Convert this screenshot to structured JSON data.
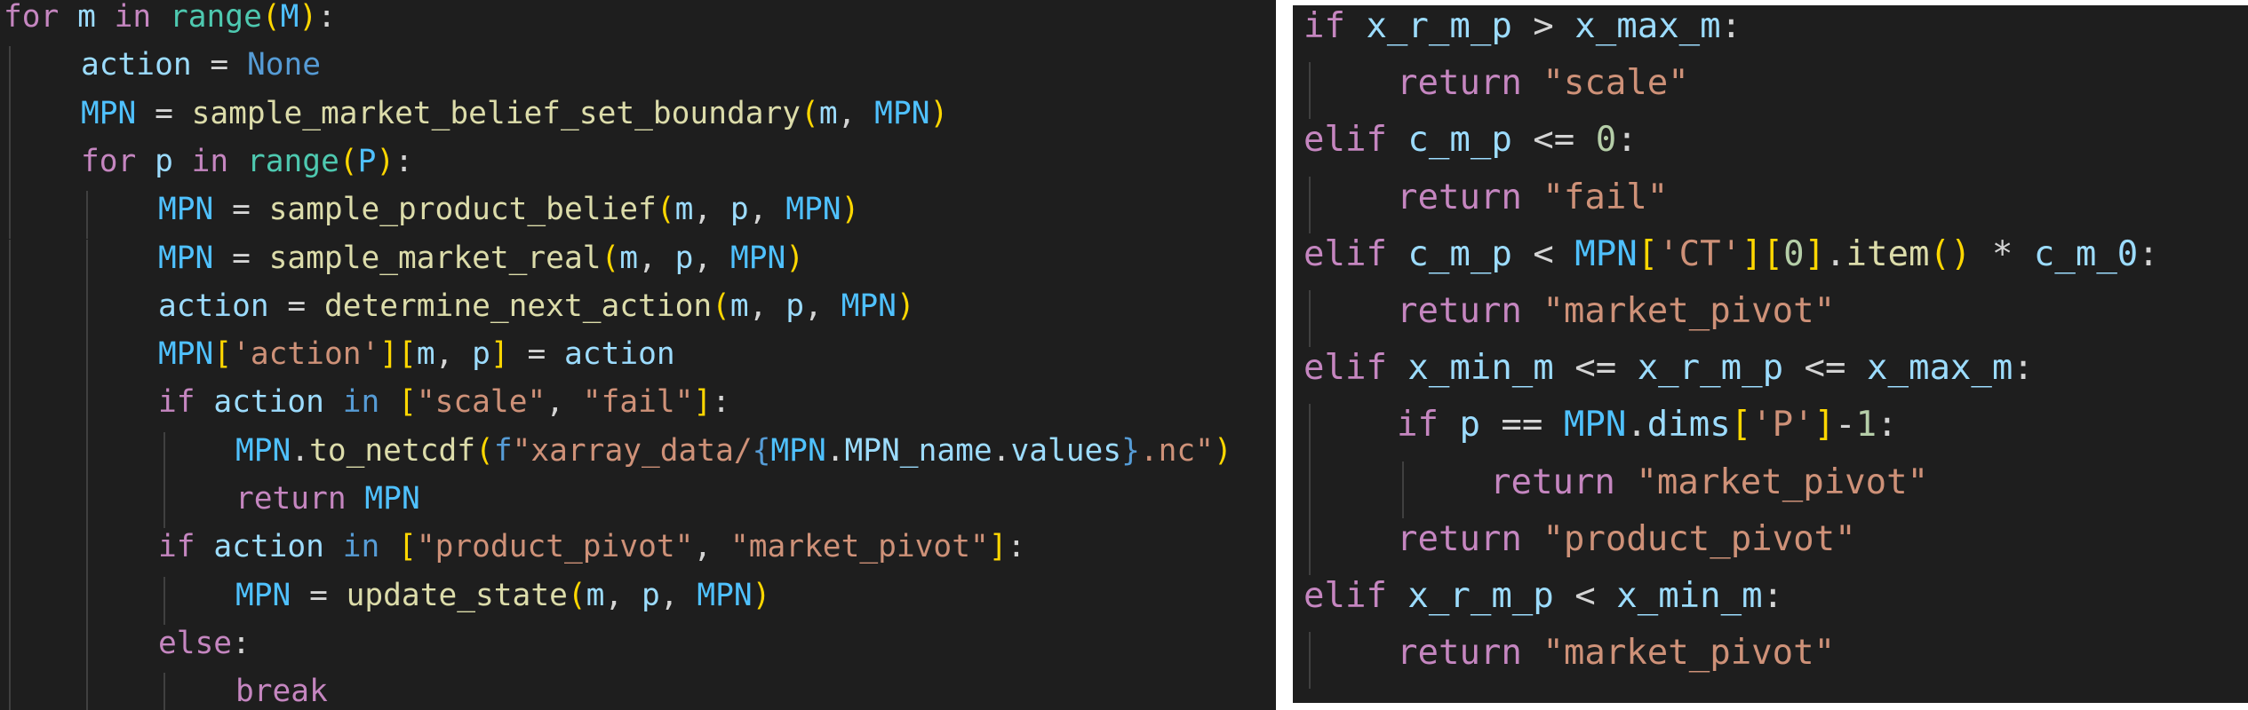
{
  "panels": [
    {
      "id": "left",
      "lines": [
        {
          "indent": 0,
          "tokens": [
            [
              "k",
              "for"
            ],
            [
              "o",
              " "
            ],
            [
              "v",
              "m"
            ],
            [
              "o",
              " "
            ],
            [
              "k",
              "in"
            ],
            [
              "o",
              " "
            ],
            [
              "b",
              "range"
            ],
            [
              "p1",
              "("
            ],
            [
              "c",
              "M"
            ],
            [
              "p1",
              ")"
            ],
            [
              "o",
              ":"
            ]
          ]
        },
        {
          "indent": 1,
          "tokens": [
            [
              "v",
              "action"
            ],
            [
              "o",
              " = "
            ],
            [
              "kb",
              "None"
            ]
          ]
        },
        {
          "indent": 1,
          "tokens": [
            [
              "c",
              "MPN"
            ],
            [
              "o",
              " = "
            ],
            [
              "f",
              "sample_market_belief_set_boundary"
            ],
            [
              "p1",
              "("
            ],
            [
              "v",
              "m"
            ],
            [
              "o",
              ", "
            ],
            [
              "c",
              "MPN"
            ],
            [
              "p1",
              ")"
            ]
          ]
        },
        {
          "indent": 1,
          "tokens": [
            [
              "k",
              "for"
            ],
            [
              "o",
              " "
            ],
            [
              "v",
              "p"
            ],
            [
              "o",
              " "
            ],
            [
              "k",
              "in"
            ],
            [
              "o",
              " "
            ],
            [
              "b",
              "range"
            ],
            [
              "p1",
              "("
            ],
            [
              "c",
              "P"
            ],
            [
              "p1",
              ")"
            ],
            [
              "o",
              ":"
            ]
          ]
        },
        {
          "indent": 2,
          "tokens": [
            [
              "c",
              "MPN"
            ],
            [
              "o",
              " = "
            ],
            [
              "f",
              "sample_product_belief"
            ],
            [
              "p1",
              "("
            ],
            [
              "v",
              "m"
            ],
            [
              "o",
              ", "
            ],
            [
              "v",
              "p"
            ],
            [
              "o",
              ", "
            ],
            [
              "c",
              "MPN"
            ],
            [
              "p1",
              ")"
            ]
          ]
        },
        {
          "indent": 2,
          "tokens": [
            [
              "c",
              "MPN"
            ],
            [
              "o",
              " = "
            ],
            [
              "f",
              "sample_market_real"
            ],
            [
              "p1",
              "("
            ],
            [
              "v",
              "m"
            ],
            [
              "o",
              ", "
            ],
            [
              "v",
              "p"
            ],
            [
              "o",
              ", "
            ],
            [
              "c",
              "MPN"
            ],
            [
              "p1",
              ")"
            ]
          ]
        },
        {
          "indent": 2,
          "tokens": [
            [
              "v",
              "action"
            ],
            [
              "o",
              " = "
            ],
            [
              "f",
              "determine_next_action"
            ],
            [
              "p1",
              "("
            ],
            [
              "v",
              "m"
            ],
            [
              "o",
              ", "
            ],
            [
              "v",
              "p"
            ],
            [
              "o",
              ", "
            ],
            [
              "c",
              "MPN"
            ],
            [
              "p1",
              ")"
            ]
          ]
        },
        {
          "indent": 2,
          "tokens": [
            [
              "c",
              "MPN"
            ],
            [
              "p1",
              "["
            ],
            [
              "s",
              "'action'"
            ],
            [
              "p1",
              "]"
            ],
            [
              "p1",
              "["
            ],
            [
              "v",
              "m"
            ],
            [
              "o",
              ", "
            ],
            [
              "v",
              "p"
            ],
            [
              "p1",
              "]"
            ],
            [
              "o",
              " = "
            ],
            [
              "v",
              "action"
            ]
          ]
        },
        {
          "indent": 2,
          "tokens": [
            [
              "k",
              "if"
            ],
            [
              "o",
              " "
            ],
            [
              "v",
              "action"
            ],
            [
              "o",
              " "
            ],
            [
              "kb",
              "in"
            ],
            [
              "o",
              " "
            ],
            [
              "p1",
              "["
            ],
            [
              "s",
              "\"scale\""
            ],
            [
              "o",
              ", "
            ],
            [
              "s",
              "\"fail\""
            ],
            [
              "p1",
              "]"
            ],
            [
              "o",
              ":"
            ]
          ]
        },
        {
          "indent": 3,
          "tokens": [
            [
              "c",
              "MPN"
            ],
            [
              "o",
              "."
            ],
            [
              "f",
              "to_netcdf"
            ],
            [
              "p1",
              "("
            ],
            [
              "kb",
              "f"
            ],
            [
              "s",
              "\"xarray_data/"
            ],
            [
              "kb",
              "{"
            ],
            [
              "c",
              "MPN"
            ],
            [
              "o",
              "."
            ],
            [
              "v",
              "MPN_name"
            ],
            [
              "o",
              "."
            ],
            [
              "v",
              "values"
            ],
            [
              "kb",
              "}"
            ],
            [
              "s",
              ".nc\""
            ],
            [
              "p1",
              ")"
            ]
          ]
        },
        {
          "indent": 3,
          "tokens": [
            [
              "k",
              "return"
            ],
            [
              "o",
              " "
            ],
            [
              "c",
              "MPN"
            ]
          ]
        },
        {
          "indent": 2,
          "tokens": [
            [
              "k",
              "if"
            ],
            [
              "o",
              " "
            ],
            [
              "v",
              "action"
            ],
            [
              "o",
              " "
            ],
            [
              "kb",
              "in"
            ],
            [
              "o",
              " "
            ],
            [
              "p1",
              "["
            ],
            [
              "s",
              "\"product_pivot\""
            ],
            [
              "o",
              ", "
            ],
            [
              "s",
              "\"market_pivot\""
            ],
            [
              "p1",
              "]"
            ],
            [
              "o",
              ":"
            ]
          ]
        },
        {
          "indent": 3,
          "tokens": [
            [
              "c",
              "MPN"
            ],
            [
              "o",
              " = "
            ],
            [
              "f",
              "update_state"
            ],
            [
              "p1",
              "("
            ],
            [
              "v",
              "m"
            ],
            [
              "o",
              ", "
            ],
            [
              "v",
              "p"
            ],
            [
              "o",
              ", "
            ],
            [
              "c",
              "MPN"
            ],
            [
              "p1",
              ")"
            ]
          ]
        },
        {
          "indent": 2,
          "tokens": [
            [
              "k",
              "else"
            ],
            [
              "o",
              ":"
            ]
          ]
        },
        {
          "indent": 3,
          "tokens": [
            [
              "k",
              "break"
            ]
          ]
        }
      ]
    },
    {
      "id": "right",
      "lines": [
        {
          "indent": 0,
          "tokens": [
            [
              "k",
              "if"
            ],
            [
              "o",
              " "
            ],
            [
              "v",
              "x_r_m_p"
            ],
            [
              "o",
              " > "
            ],
            [
              "v",
              "x_max_m"
            ],
            [
              "o",
              ":"
            ]
          ]
        },
        {
          "indent": 1,
          "tokens": [
            [
              "k",
              "return"
            ],
            [
              "o",
              " "
            ],
            [
              "s",
              "\"scale\""
            ]
          ]
        },
        {
          "indent": 0,
          "tokens": [
            [
              "k",
              "elif"
            ],
            [
              "o",
              " "
            ],
            [
              "v",
              "c_m_p"
            ],
            [
              "o",
              " <= "
            ],
            [
              "n",
              "0"
            ],
            [
              "o",
              ":"
            ]
          ]
        },
        {
          "indent": 1,
          "tokens": [
            [
              "k",
              "return"
            ],
            [
              "o",
              " "
            ],
            [
              "s",
              "\"fail\""
            ]
          ]
        },
        {
          "indent": 0,
          "tokens": [
            [
              "k",
              "elif"
            ],
            [
              "o",
              " "
            ],
            [
              "v",
              "c_m_p"
            ],
            [
              "o",
              " < "
            ],
            [
              "c",
              "MPN"
            ],
            [
              "p1",
              "["
            ],
            [
              "s",
              "'CT'"
            ],
            [
              "p1",
              "]"
            ],
            [
              "p1",
              "["
            ],
            [
              "n",
              "0"
            ],
            [
              "p1",
              "]"
            ],
            [
              "o",
              "."
            ],
            [
              "f",
              "item"
            ],
            [
              "p1",
              "()"
            ],
            [
              "o",
              " * "
            ],
            [
              "v",
              "c_m_0"
            ],
            [
              "o",
              ":"
            ]
          ]
        },
        {
          "indent": 1,
          "tokens": [
            [
              "k",
              "return"
            ],
            [
              "o",
              " "
            ],
            [
              "s",
              "\"market_pivot\""
            ]
          ]
        },
        {
          "indent": 0,
          "tokens": [
            [
              "k",
              "elif"
            ],
            [
              "o",
              " "
            ],
            [
              "v",
              "x_min_m"
            ],
            [
              "o",
              " <= "
            ],
            [
              "v",
              "x_r_m_p"
            ],
            [
              "o",
              " <= "
            ],
            [
              "v",
              "x_max_m"
            ],
            [
              "o",
              ":"
            ]
          ]
        },
        {
          "indent": 1,
          "tokens": [
            [
              "k",
              "if"
            ],
            [
              "o",
              " "
            ],
            [
              "v",
              "p"
            ],
            [
              "o",
              " == "
            ],
            [
              "c",
              "MPN"
            ],
            [
              "o",
              "."
            ],
            [
              "v",
              "dims"
            ],
            [
              "p1",
              "["
            ],
            [
              "s",
              "'P'"
            ],
            [
              "p1",
              "]"
            ],
            [
              "o",
              "-"
            ],
            [
              "n",
              "1"
            ],
            [
              "o",
              ":"
            ]
          ]
        },
        {
          "indent": 2,
          "tokens": [
            [
              "k",
              "return"
            ],
            [
              "o",
              " "
            ],
            [
              "s",
              "\"market_pivot\""
            ]
          ]
        },
        {
          "indent": 1,
          "tokens": [
            [
              "k",
              "return"
            ],
            [
              "o",
              " "
            ],
            [
              "s",
              "\"product_pivot\""
            ]
          ]
        },
        {
          "indent": 0,
          "tokens": [
            [
              "k",
              "elif"
            ],
            [
              "o",
              " "
            ],
            [
              "v",
              "x_r_m_p"
            ],
            [
              "o",
              " < "
            ],
            [
              "v",
              "x_min_m"
            ],
            [
              "o",
              ":"
            ]
          ]
        },
        {
          "indent": 1,
          "tokens": [
            [
              "k",
              "return"
            ],
            [
              "o",
              " "
            ],
            [
              "s",
              "\"market_pivot\""
            ]
          ]
        }
      ]
    }
  ]
}
